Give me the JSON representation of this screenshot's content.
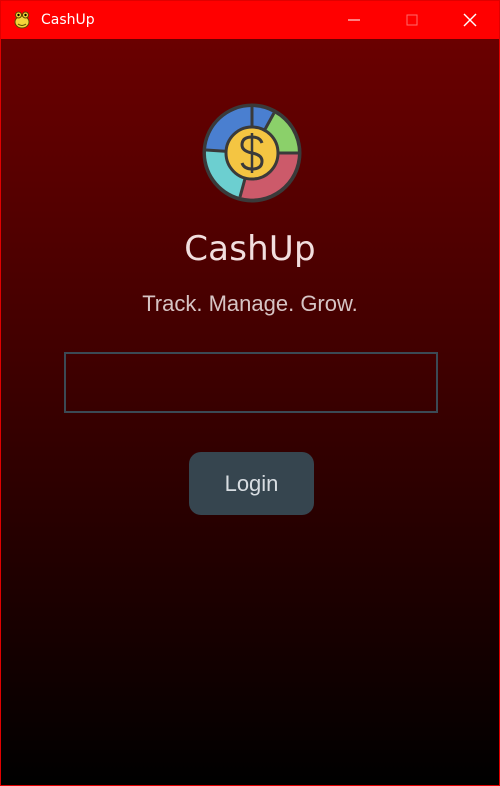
{
  "window": {
    "title": "CashUp",
    "icon": "python-snake-icon",
    "controls": [
      "minimize-icon",
      "maximize-icon",
      "close-icon"
    ],
    "titlebar_color": "#ff0000"
  },
  "app": {
    "name": "CashUp",
    "tagline": "Track. Manage. Grow.",
    "logo_icon": "dollar-coin-icon",
    "colors": {
      "background_top": "#6a0000",
      "background_bottom": "#000000",
      "input_border": "#3b4a55",
      "button_bg": "#36454f",
      "button_text": "#d8dde2"
    }
  },
  "login": {
    "input_value": "",
    "input_placeholder": "",
    "button_label": "Login"
  }
}
